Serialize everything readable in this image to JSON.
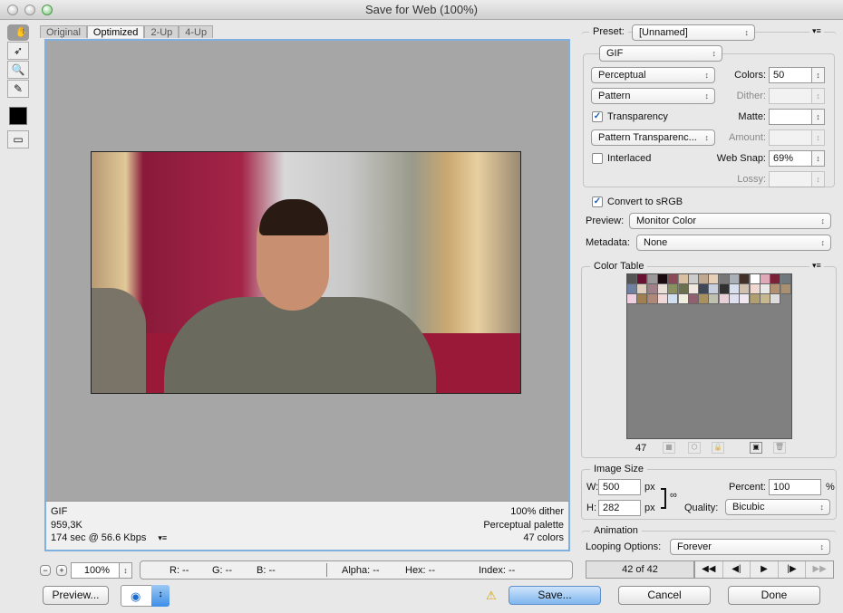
{
  "window": {
    "title": "Save for Web (100%)"
  },
  "tools": [
    {
      "icon": "hand-icon",
      "glyph": "✋"
    },
    {
      "icon": "slice-select-icon",
      "glyph": "➶"
    },
    {
      "icon": "zoom-icon",
      "glyph": "🔍"
    },
    {
      "icon": "eyedropper-icon",
      "glyph": "✎"
    }
  ],
  "tabs": [
    {
      "label": "Original"
    },
    {
      "label": "Optimized"
    },
    {
      "label": "2-Up"
    },
    {
      "label": "4-Up"
    }
  ],
  "info": {
    "format": "GIF",
    "size": "959,3K",
    "time": "174 sec @ 56.6 Kbps",
    "dither": "100% dither",
    "palette": "Perceptual palette",
    "colors": "47 colors"
  },
  "statusbar": {
    "zoom": "100%",
    "r": "R: --",
    "g": "G: --",
    "b": "B: --",
    "alpha": "Alpha: --",
    "hex": "Hex: --",
    "index": "Index: --"
  },
  "bottom": {
    "preview": "Preview...",
    "save": "Save...",
    "cancel": "Cancel",
    "done": "Done"
  },
  "settings": {
    "preset_label": "Preset:",
    "preset": "[Unnamed]",
    "format": "GIF",
    "reduction": "Perceptual",
    "dither_algo": "Pattern",
    "colors_label": "Colors:",
    "colors": "50",
    "dither_label": "Dither:",
    "dither": "",
    "transparency_label": "Transparency",
    "transparency": true,
    "matte_label": "Matte:",
    "matte": "",
    "transparency_dither": "Pattern Transparenc...",
    "amount_label": "Amount:",
    "amount": "",
    "interlaced_label": "Interlaced",
    "interlaced": false,
    "websnap_label": "Web Snap:",
    "websnap": "69%",
    "lossy_label": "Lossy:",
    "lossy": "",
    "srgb_label": "Convert to sRGB",
    "srgb": true,
    "preview_label": "Preview:",
    "preview": "Monitor Color",
    "metadata_label": "Metadata:",
    "metadata": "None"
  },
  "color_table": {
    "title": "Color Table",
    "count": "47",
    "colors": [
      "#555555",
      "#6a1030",
      "#999999",
      "#1a0a10",
      "#8a4a58",
      "#d8c0a0",
      "#cccccc",
      "#c0a890",
      "#e8d0b8",
      "#777777",
      "#aab0b8",
      "#403028",
      "#ffffff",
      "#e0a8b8",
      "#7a2038",
      "#707880",
      "#7080a0",
      "#e0d0c0",
      "#a08088",
      "#e8e0d8",
      "#8a9060",
      "#6a7050",
      "#f0e8e0",
      "#404858",
      "#c8d0e0",
      "#303030",
      "#d8e0f0",
      "#d0c0b0",
      "#f0d8d0",
      "#e8e8e8",
      "#b09070",
      "#a89070",
      "#f0d0e0",
      "#a08050",
      "#b08878",
      "#f0d8d8",
      "#d0e0f0",
      "#f0f0e0",
      "#906070",
      "#a89060",
      "#c0c0b0",
      "#e8d0d8",
      "#e0e0f0",
      "#f0e8f0",
      "#b0a070",
      "#c8b890",
      "#dddddd"
    ]
  },
  "image_size": {
    "title": "Image Size",
    "w_label": "W:",
    "w": "500",
    "h_label": "H:",
    "h": "282",
    "unit": "px",
    "percent_label": "Percent:",
    "percent": "100",
    "pct": "%",
    "quality_label": "Quality:",
    "quality": "Bicubic"
  },
  "animation": {
    "title": "Animation",
    "looping_label": "Looping Options:",
    "looping": "Forever",
    "frame": "42 of 42"
  }
}
